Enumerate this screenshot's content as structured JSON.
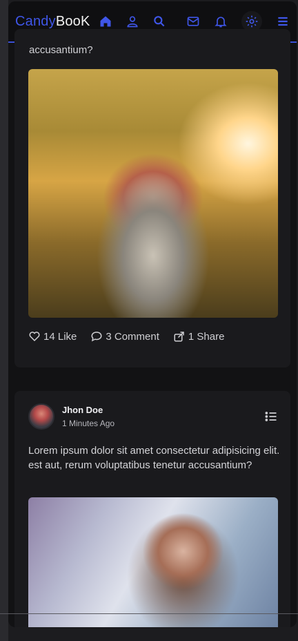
{
  "navbar": {
    "brand_first": "Candy",
    "brand_second": "BooK",
    "icons": [
      "home-icon",
      "user-icon",
      "search-icon",
      "mail-icon",
      "bell-icon",
      "gear-icon",
      "hamburger-menu-icon"
    ],
    "accent": "#3f56e8"
  },
  "post1": {
    "text_tail": "accusantium?",
    "likes_label": "14 Like",
    "comments_label": "3 Comment",
    "shares_label": "1 Share"
  },
  "post2": {
    "author": "Jhon Doe",
    "time": "1 Minutes Ago",
    "text": "Lorem ipsum dolor sit amet consectetur adipisicing elit. est aut, rerum voluptatibus tenetur accusantium?"
  }
}
